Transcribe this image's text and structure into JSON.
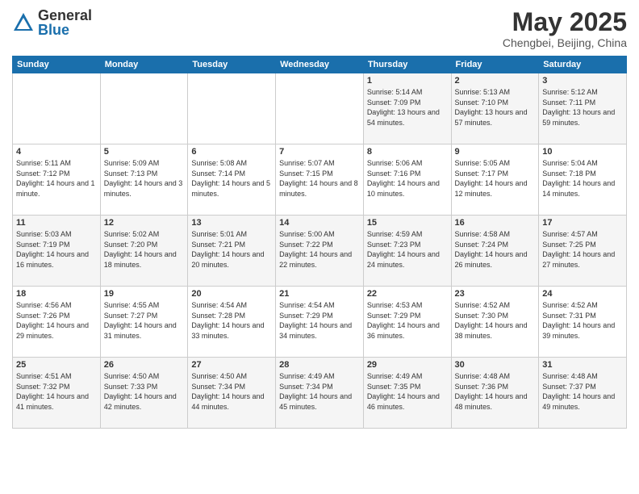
{
  "logo": {
    "general": "General",
    "blue": "Blue"
  },
  "header": {
    "month": "May 2025",
    "location": "Chengbei, Beijing, China"
  },
  "weekdays": [
    "Sunday",
    "Monday",
    "Tuesday",
    "Wednesday",
    "Thursday",
    "Friday",
    "Saturday"
  ],
  "weeks": [
    [
      {
        "day": "",
        "empty": true
      },
      {
        "day": "",
        "empty": true
      },
      {
        "day": "",
        "empty": true
      },
      {
        "day": "",
        "empty": true
      },
      {
        "day": "1",
        "sunrise": "5:14 AM",
        "sunset": "7:09 PM",
        "daylight": "13 hours and 54 minutes."
      },
      {
        "day": "2",
        "sunrise": "5:13 AM",
        "sunset": "7:10 PM",
        "daylight": "13 hours and 57 minutes."
      },
      {
        "day": "3",
        "sunrise": "5:12 AM",
        "sunset": "7:11 PM",
        "daylight": "13 hours and 59 minutes."
      }
    ],
    [
      {
        "day": "4",
        "sunrise": "5:11 AM",
        "sunset": "7:12 PM",
        "daylight": "14 hours and 1 minute."
      },
      {
        "day": "5",
        "sunrise": "5:09 AM",
        "sunset": "7:13 PM",
        "daylight": "14 hours and 3 minutes."
      },
      {
        "day": "6",
        "sunrise": "5:08 AM",
        "sunset": "7:14 PM",
        "daylight": "14 hours and 5 minutes."
      },
      {
        "day": "7",
        "sunrise": "5:07 AM",
        "sunset": "7:15 PM",
        "daylight": "14 hours and 8 minutes."
      },
      {
        "day": "8",
        "sunrise": "5:06 AM",
        "sunset": "7:16 PM",
        "daylight": "14 hours and 10 minutes."
      },
      {
        "day": "9",
        "sunrise": "5:05 AM",
        "sunset": "7:17 PM",
        "daylight": "14 hours and 12 minutes."
      },
      {
        "day": "10",
        "sunrise": "5:04 AM",
        "sunset": "7:18 PM",
        "daylight": "14 hours and 14 minutes."
      }
    ],
    [
      {
        "day": "11",
        "sunrise": "5:03 AM",
        "sunset": "7:19 PM",
        "daylight": "14 hours and 16 minutes."
      },
      {
        "day": "12",
        "sunrise": "5:02 AM",
        "sunset": "7:20 PM",
        "daylight": "14 hours and 18 minutes."
      },
      {
        "day": "13",
        "sunrise": "5:01 AM",
        "sunset": "7:21 PM",
        "daylight": "14 hours and 20 minutes."
      },
      {
        "day": "14",
        "sunrise": "5:00 AM",
        "sunset": "7:22 PM",
        "daylight": "14 hours and 22 minutes."
      },
      {
        "day": "15",
        "sunrise": "4:59 AM",
        "sunset": "7:23 PM",
        "daylight": "14 hours and 24 minutes."
      },
      {
        "day": "16",
        "sunrise": "4:58 AM",
        "sunset": "7:24 PM",
        "daylight": "14 hours and 26 minutes."
      },
      {
        "day": "17",
        "sunrise": "4:57 AM",
        "sunset": "7:25 PM",
        "daylight": "14 hours and 27 minutes."
      }
    ],
    [
      {
        "day": "18",
        "sunrise": "4:56 AM",
        "sunset": "7:26 PM",
        "daylight": "14 hours and 29 minutes."
      },
      {
        "day": "19",
        "sunrise": "4:55 AM",
        "sunset": "7:27 PM",
        "daylight": "14 hours and 31 minutes."
      },
      {
        "day": "20",
        "sunrise": "4:54 AM",
        "sunset": "7:28 PM",
        "daylight": "14 hours and 33 minutes."
      },
      {
        "day": "21",
        "sunrise": "4:54 AM",
        "sunset": "7:29 PM",
        "daylight": "14 hours and 34 minutes."
      },
      {
        "day": "22",
        "sunrise": "4:53 AM",
        "sunset": "7:29 PM",
        "daylight": "14 hours and 36 minutes."
      },
      {
        "day": "23",
        "sunrise": "4:52 AM",
        "sunset": "7:30 PM",
        "daylight": "14 hours and 38 minutes."
      },
      {
        "day": "24",
        "sunrise": "4:52 AM",
        "sunset": "7:31 PM",
        "daylight": "14 hours and 39 minutes."
      }
    ],
    [
      {
        "day": "25",
        "sunrise": "4:51 AM",
        "sunset": "7:32 PM",
        "daylight": "14 hours and 41 minutes."
      },
      {
        "day": "26",
        "sunrise": "4:50 AM",
        "sunset": "7:33 PM",
        "daylight": "14 hours and 42 minutes."
      },
      {
        "day": "27",
        "sunrise": "4:50 AM",
        "sunset": "7:34 PM",
        "daylight": "14 hours and 44 minutes."
      },
      {
        "day": "28",
        "sunrise": "4:49 AM",
        "sunset": "7:34 PM",
        "daylight": "14 hours and 45 minutes."
      },
      {
        "day": "29",
        "sunrise": "4:49 AM",
        "sunset": "7:35 PM",
        "daylight": "14 hours and 46 minutes."
      },
      {
        "day": "30",
        "sunrise": "4:48 AM",
        "sunset": "7:36 PM",
        "daylight": "14 hours and 48 minutes."
      },
      {
        "day": "31",
        "sunrise": "4:48 AM",
        "sunset": "7:37 PM",
        "daylight": "14 hours and 49 minutes."
      }
    ]
  ]
}
